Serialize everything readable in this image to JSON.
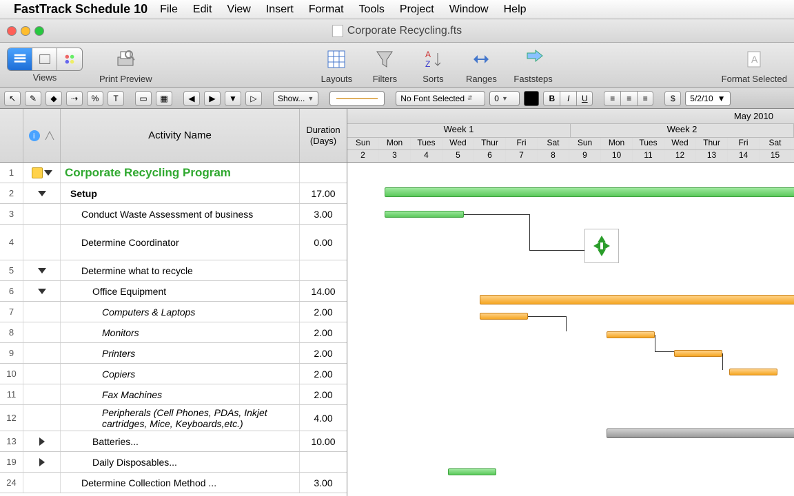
{
  "menubar": {
    "app": "FastTrack Schedule 10",
    "items": [
      "File",
      "Edit",
      "View",
      "Insert",
      "Format",
      "Tools",
      "Project",
      "Window",
      "Help"
    ]
  },
  "window": {
    "title": "Corporate Recycling.fts"
  },
  "toolbar1": {
    "views": "Views",
    "print_preview": "Print Preview",
    "layouts": "Layouts",
    "filters": "Filters",
    "sorts": "Sorts",
    "ranges": "Ranges",
    "faststeps": "Faststeps",
    "format_selected": "Format Selected"
  },
  "toolbar2": {
    "show": "Show...",
    "font": "No Font Selected",
    "size": "0",
    "b": "B",
    "i": "I",
    "u": "U",
    "date_prefix": "$",
    "date": "5/2/10"
  },
  "columns": {
    "activity": "Activity Name",
    "duration": "Duration (Days)"
  },
  "timeline": {
    "month": "May 2010",
    "weeks": [
      "Week 1",
      "Week 2"
    ],
    "days": [
      "Sun",
      "Mon",
      "Tues",
      "Wed",
      "Thur",
      "Fri",
      "Sat",
      "Sun",
      "Mon",
      "Tues",
      "Wed",
      "Thur",
      "Fri",
      "Sat"
    ],
    "dates": [
      "2",
      "3",
      "4",
      "5",
      "6",
      "7",
      "8",
      "9",
      "10",
      "11",
      "12",
      "13",
      "14",
      "15"
    ]
  },
  "rows": [
    {
      "n": "1",
      "name": "Corporate Recycling Program",
      "dur": "",
      "title": true,
      "note": true,
      "exp": "down"
    },
    {
      "n": "2",
      "name": "Setup",
      "dur": "17.00",
      "bold": true,
      "indent": 1,
      "exp": "down"
    },
    {
      "n": "3",
      "name": "Conduct Waste Assessment of business",
      "dur": "3.00",
      "indent": 2
    },
    {
      "n": "4",
      "name": "Determine Coordinator",
      "dur": "0.00",
      "indent": 2,
      "tall": true
    },
    {
      "n": "5",
      "name": "Determine what to recycle",
      "dur": "",
      "indent": 2,
      "exp": "down"
    },
    {
      "n": "6",
      "name": "Office Equipment",
      "dur": "14.00",
      "indent": 3,
      "exp": "down"
    },
    {
      "n": "7",
      "name": "Computers & Laptops",
      "dur": "2.00",
      "indent": 4
    },
    {
      "n": "8",
      "name": "Monitors",
      "dur": "2.00",
      "indent": 4
    },
    {
      "n": "9",
      "name": "Printers",
      "dur": "2.00",
      "indent": 4
    },
    {
      "n": "10",
      "name": "Copiers",
      "dur": "2.00",
      "indent": 4
    },
    {
      "n": "11",
      "name": "Fax Machines",
      "dur": "2.00",
      "indent": 4
    },
    {
      "n": "12",
      "name": "Peripherals (Cell Phones, PDAs, Inkjet cartridges, Mice, Keyboards,etc.)",
      "dur": "4.00",
      "indent": 4,
      "text2": true
    },
    {
      "n": "13",
      "name": "Batteries...",
      "dur": "10.00",
      "indent": 3,
      "exp": "right"
    },
    {
      "n": "19",
      "name": "Daily Disposables...",
      "dur": "",
      "indent": 3,
      "exp": "right"
    },
    {
      "n": "24",
      "name": "Determine Collection Method ...",
      "dur": "3.00",
      "indent": 2
    }
  ]
}
